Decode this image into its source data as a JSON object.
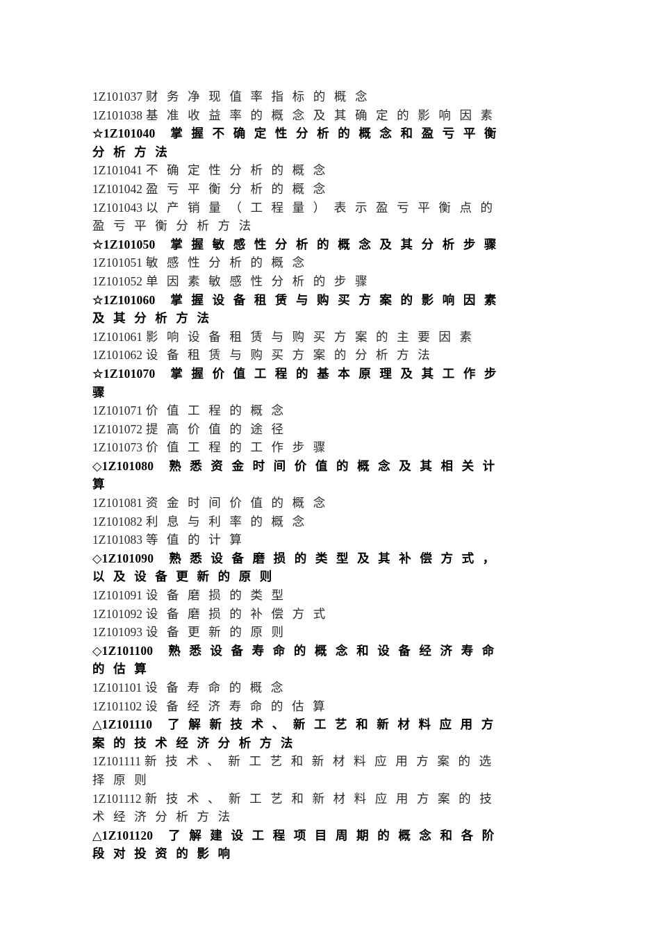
{
  "document": {
    "type": "syllabus-outline",
    "page_background": "#ffffff",
    "text_color": "#1a1a1a",
    "markers": {
      "master": "☆",
      "familiar": "◇",
      "understand": "△"
    },
    "lines": [
      {
        "id": "l1",
        "style": "normal",
        "code": "1Z101037",
        "text": "财务净现值率指标的概念",
        "track": "t-tight"
      },
      {
        "id": "l2",
        "style": "normal",
        "code": "1Z101038",
        "text": "基准收益率的概念及其确定的影响因素",
        "track": "t-tight"
      },
      {
        "id": "l3",
        "style": "head",
        "code": "☆1Z101040",
        "text": "掌握不确定性分析的概念和盈亏平衡",
        "track": "t-head"
      },
      {
        "id": "l4",
        "style": "head",
        "code": "",
        "text": "分析方法",
        "track": "t-cont"
      },
      {
        "id": "l5",
        "style": "normal",
        "code": "1Z101041",
        "text": "不确定性分析的概念",
        "track": "t-tight"
      },
      {
        "id": "l6",
        "style": "normal",
        "code": "1Z101042",
        "text": "盈亏平衡分析的概念",
        "track": "t-tight"
      },
      {
        "id": "l7",
        "style": "normal",
        "code": "1Z101043",
        "text": "以产销量（工程量）表示盈亏平衡点的",
        "track": "t-tight"
      },
      {
        "id": "l8",
        "style": "normal",
        "code": "",
        "text": "盈亏平衡分析方法",
        "track": "t-cont"
      },
      {
        "id": "l9",
        "style": "head",
        "code": "☆1Z101050",
        "text": "掌握敏感性分析的概念及其分析步骤",
        "track": "t-head"
      },
      {
        "id": "l10",
        "style": "normal",
        "code": "1Z101051",
        "text": "敏感性分析的概念",
        "track": "t-tight"
      },
      {
        "id": "l11",
        "style": "normal",
        "code": "1Z101052",
        "text": "单因素敏感性分析的步骤",
        "track": "t-tight"
      },
      {
        "id": "l12",
        "style": "head",
        "code": "☆1Z101060",
        "text": "掌握设备租赁与购买方案的影响因素",
        "track": "t-head"
      },
      {
        "id": "l13",
        "style": "head",
        "code": "",
        "text": "及其分析方法",
        "track": "t-cont"
      },
      {
        "id": "l14",
        "style": "normal",
        "code": "1Z101061",
        "text": "影响设备租赁与购买方案的主要因素",
        "track": "t-tight"
      },
      {
        "id": "l15",
        "style": "normal",
        "code": "1Z101062",
        "text": "设备租赁与购买方案的分析方法",
        "track": "t-tight"
      },
      {
        "id": "l16",
        "style": "head",
        "code": "☆1Z101070",
        "text": "掌握价值工程的基本原理及其工作步",
        "track": "t-head"
      },
      {
        "id": "l17",
        "style": "head",
        "code": "",
        "text": "骤",
        "track": "t-cont"
      },
      {
        "id": "l18",
        "style": "normal",
        "code": "1Z101071",
        "text": "价值工程的概念",
        "track": "t-tight"
      },
      {
        "id": "l19",
        "style": "normal",
        "code": "1Z101072",
        "text": "提高价值的途径",
        "track": "t-tight"
      },
      {
        "id": "l20",
        "style": "normal",
        "code": "1Z101073",
        "text": "价值工程的工作步骤",
        "track": "t-tight"
      },
      {
        "id": "l21",
        "style": "head",
        "code": "◇1Z101080",
        "text": "熟悉资金时间价值的概念及其相关计",
        "track": "t-head"
      },
      {
        "id": "l22",
        "style": "head",
        "code": "",
        "text": "算",
        "track": "t-cont"
      },
      {
        "id": "l23",
        "style": "normal",
        "code": "1Z101081",
        "text": "资金时间价值的概念",
        "track": "t-tight"
      },
      {
        "id": "l24",
        "style": "normal",
        "code": "1Z101082",
        "text": "利息与利率的概念",
        "track": "t-tight"
      },
      {
        "id": "l25",
        "style": "normal",
        "code": "1Z101083",
        "text": "等值的计算",
        "track": "t-tight"
      },
      {
        "id": "l26",
        "style": "head",
        "code": "◇1Z101090",
        "text": "熟悉设备磨损的类型及其补偿方式，",
        "track": "t-head"
      },
      {
        "id": "l27",
        "style": "head",
        "code": "",
        "text": "以及设备更新的原则",
        "track": "t-cont"
      },
      {
        "id": "l28",
        "style": "normal",
        "code": "1Z101091",
        "text": "设备磨损的类型",
        "track": "t-tight"
      },
      {
        "id": "l29",
        "style": "normal",
        "code": "1Z101092",
        "text": "设备磨损的补偿方式",
        "track": "t-tight"
      },
      {
        "id": "l30",
        "style": "normal",
        "code": "1Z101093",
        "text": "设备更新的原则",
        "track": "t-tight"
      },
      {
        "id": "l31",
        "style": "head",
        "code": "◇1Z101100",
        "text": "熟悉设备寿命的概念和设备经济寿命",
        "track": "t-head"
      },
      {
        "id": "l32",
        "style": "head",
        "code": "",
        "text": "的估算",
        "track": "t-cont"
      },
      {
        "id": "l33",
        "style": "normal",
        "code": "1Z101101",
        "text": "设备寿命的概念",
        "track": "t-tight"
      },
      {
        "id": "l34",
        "style": "normal",
        "code": "1Z101102",
        "text": "设备经济寿命的估算",
        "track": "t-tight"
      },
      {
        "id": "l35",
        "style": "head",
        "code": "△1Z101110",
        "text": "了解新技术、新工艺和新材料应用方",
        "track": "t-head"
      },
      {
        "id": "l36",
        "style": "head",
        "code": "",
        "text": "案的技术经济分析方法",
        "track": "t-cont"
      },
      {
        "id": "l37",
        "style": "normal",
        "code": "1Z101111",
        "text": "新技术、新工艺和新材料应用方案的选",
        "track": "t-tight"
      },
      {
        "id": "l38",
        "style": "normal",
        "code": "",
        "text": "择原则",
        "track": "t-cont"
      },
      {
        "id": "l39",
        "style": "normal",
        "code": "1Z101112",
        "text": "新技术、新工艺和新材料应用方案的技",
        "track": "t-tight"
      },
      {
        "id": "l40",
        "style": "normal",
        "code": "",
        "text": "术经济分析方法",
        "track": "t-cont"
      },
      {
        "id": "l41",
        "style": "head",
        "code": "△1Z101120",
        "text": "了解建设工程项目周期的概念和各阶",
        "track": "t-head"
      },
      {
        "id": "l42",
        "style": "head",
        "code": "",
        "text": "段对投资的影响",
        "track": "t-cont"
      }
    ]
  }
}
